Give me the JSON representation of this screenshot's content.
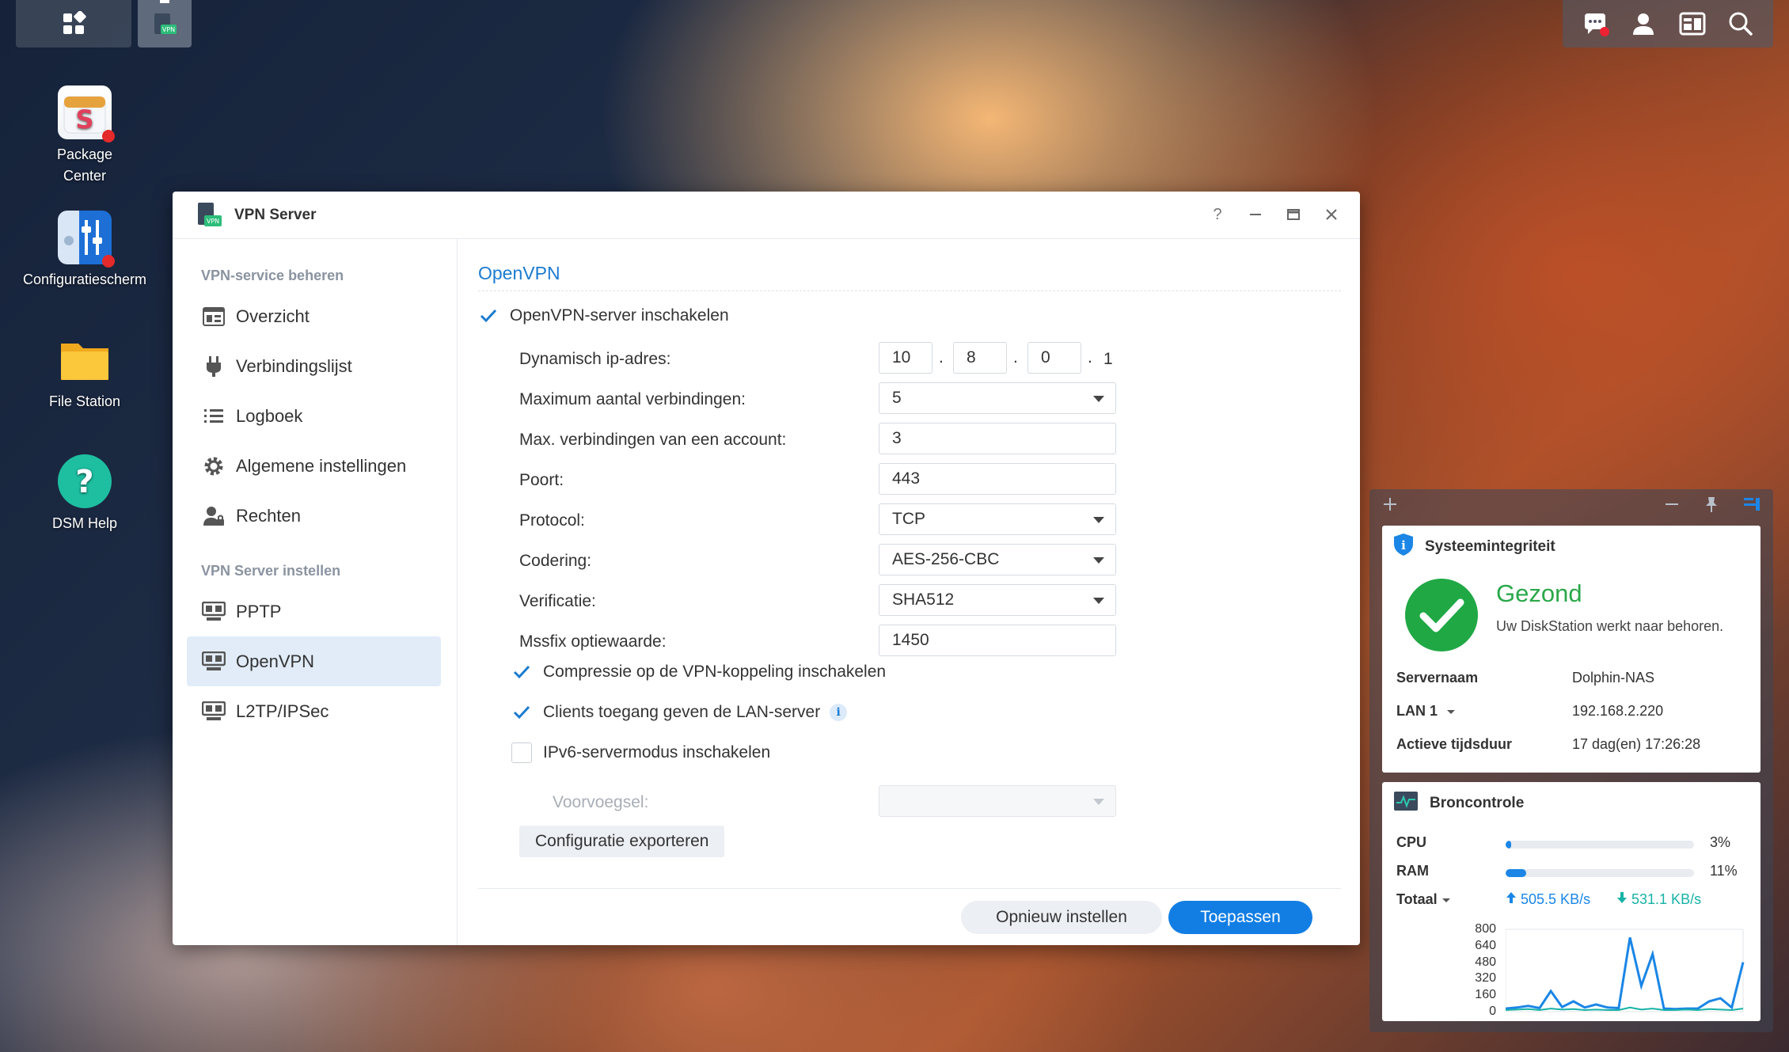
{
  "desktop": {
    "icons": [
      {
        "label": "Package\nCenter",
        "line1": "Package",
        "line2": "Center"
      },
      {
        "label": "Configuratiescherm"
      },
      {
        "label": "File Station"
      },
      {
        "label": "DSM Help"
      }
    ]
  },
  "window": {
    "title": "VPN Server",
    "sidebar": {
      "section1": "VPN-service beheren",
      "items1": [
        "Overzicht",
        "Verbindingslijst",
        "Logboek",
        "Algemene instellingen",
        "Rechten"
      ],
      "section2": "VPN Server instellen",
      "items2": [
        "PPTP",
        "OpenVPN",
        "L2TP/IPSec"
      ]
    },
    "main": {
      "title": "OpenVPN",
      "enable_label": "OpenVPN-server inschakelen",
      "dynamic_ip_label": "Dynamisch ip-adres:",
      "ip": [
        "10",
        "8",
        "0",
        "1"
      ],
      "max_conn_label": "Maximum aantal verbindingen:",
      "max_conn_value": "5",
      "max_account_label": "Max. verbindingen van een account:",
      "max_account_value": "3",
      "port_label": "Poort:",
      "port_value": "443",
      "protocol_label": "Protocol:",
      "protocol_value": "TCP",
      "encoding_label": "Codering:",
      "encoding_value": "AES-256-CBC",
      "verification_label": "Verificatie:",
      "verification_value": "SHA512",
      "mssfix_label": "Mssfix optiewaarde:",
      "mssfix_value": "1450",
      "compression_label": "Compressie op de VPN-koppeling inschakelen",
      "lan_label": "Clients toegang geven de LAN-server",
      "ipv6_label": "IPv6-servermodus inschakelen",
      "prefix_label": "Voorvoegsel:",
      "export_button": "Configuratie exporteren",
      "reset_button": "Opnieuw instellen",
      "apply_button": "Toepassen"
    }
  },
  "widgets": {
    "health": {
      "title": "Systeemintegriteit",
      "status": "Gezond",
      "message": "Uw DiskStation werkt naar behoren.",
      "server_label": "Servernaam",
      "server_value": "Dolphin-NAS",
      "lan_label": "LAN 1",
      "lan_value": "192.168.2.220",
      "uptime_label": "Actieve tijdsduur",
      "uptime_value": "17 dag(en) 17:26:28"
    },
    "resources": {
      "title": "Broncontrole",
      "cpu_label": "CPU",
      "cpu_pct": "3%",
      "cpu_value": 3,
      "ram_label": "RAM",
      "ram_pct": "11%",
      "ram_value": 11,
      "total_label": "Totaal",
      "upload": "505.5 KB/s",
      "download": "531.1 KB/s"
    }
  },
  "chart_data": {
    "type": "line",
    "ylim": [
      0,
      800
    ],
    "yticks": [
      "800",
      "640",
      "480",
      "320",
      "160",
      "0"
    ],
    "series": [
      {
        "values": [
          30,
          40,
          55,
          35,
          200,
          45,
          100,
          40,
          70,
          40,
          35,
          720,
          250,
          560,
          30,
          25,
          30,
          30,
          100,
          130,
          40,
          480
        ]
      },
      {
        "values": [
          15,
          20,
          25,
          15,
          30,
          20,
          25,
          15,
          20,
          15,
          15,
          40,
          20,
          30,
          15,
          15,
          20,
          15,
          25,
          20,
          15,
          30
        ]
      }
    ],
    "colors": {
      "upload": "#1b86e6",
      "download": "#17b2a6"
    }
  }
}
